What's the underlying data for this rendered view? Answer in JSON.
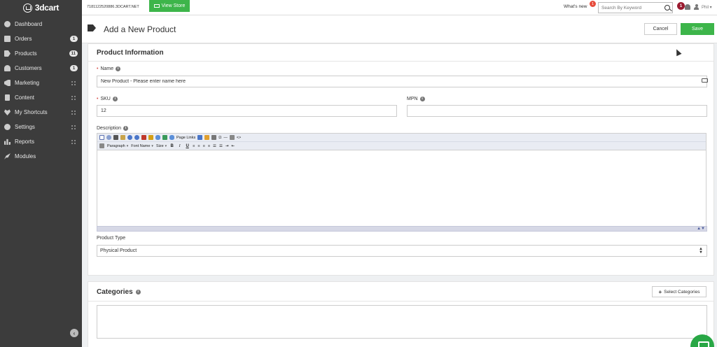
{
  "topbar": {
    "logo_text": "3dcart",
    "store_url": "7181122520886.3DCART.NET",
    "view_store_label": "View Store",
    "whats_new_label": "What's new",
    "whats_new_count": "1",
    "search_placeholder": "Search By Keyword",
    "notification_count": "1",
    "user_name": "Phil"
  },
  "sidebar": {
    "items": [
      {
        "label": "Dashboard",
        "icon": "dashboard-icon"
      },
      {
        "label": "Orders",
        "icon": "cart-icon",
        "badge": "1"
      },
      {
        "label": "Products",
        "icon": "tags-icon",
        "badge": "11"
      },
      {
        "label": "Customers",
        "icon": "user-icon",
        "badge": "1"
      },
      {
        "label": "Marketing",
        "icon": "bullhorn-icon"
      },
      {
        "label": "Content",
        "icon": "file-icon"
      },
      {
        "label": "My Shortcuts",
        "icon": "heart-icon"
      },
      {
        "label": "Settings",
        "icon": "gears-icon"
      },
      {
        "label": "Reports",
        "icon": "bar-chart-icon"
      },
      {
        "label": "Modules",
        "icon": "rocket-icon"
      }
    ]
  },
  "header": {
    "title": "Add a New Product",
    "cancel_label": "Cancel",
    "save_label": "Save"
  },
  "product_info": {
    "title": "Product Information",
    "name_label": "Name",
    "name_value": "New Product - Please enter name here",
    "sku_label": "SKU",
    "sku_value": "12",
    "mpn_label": "MPN",
    "mpn_value": "",
    "description_label": "Description",
    "toolbar": {
      "page_links": "Page Links",
      "paragraph": "Paragraph",
      "font_name": "Font Name",
      "size": "Size"
    },
    "product_type_label": "Product Type",
    "product_type_value": "Physical Product"
  },
  "categories": {
    "title": "Categories",
    "select_button_label": "Select Categories"
  },
  "colors": {
    "sidebar_bg": "#3c3c3c",
    "accent_green": "#3db54a",
    "badge_red": "#e74c3c"
  }
}
